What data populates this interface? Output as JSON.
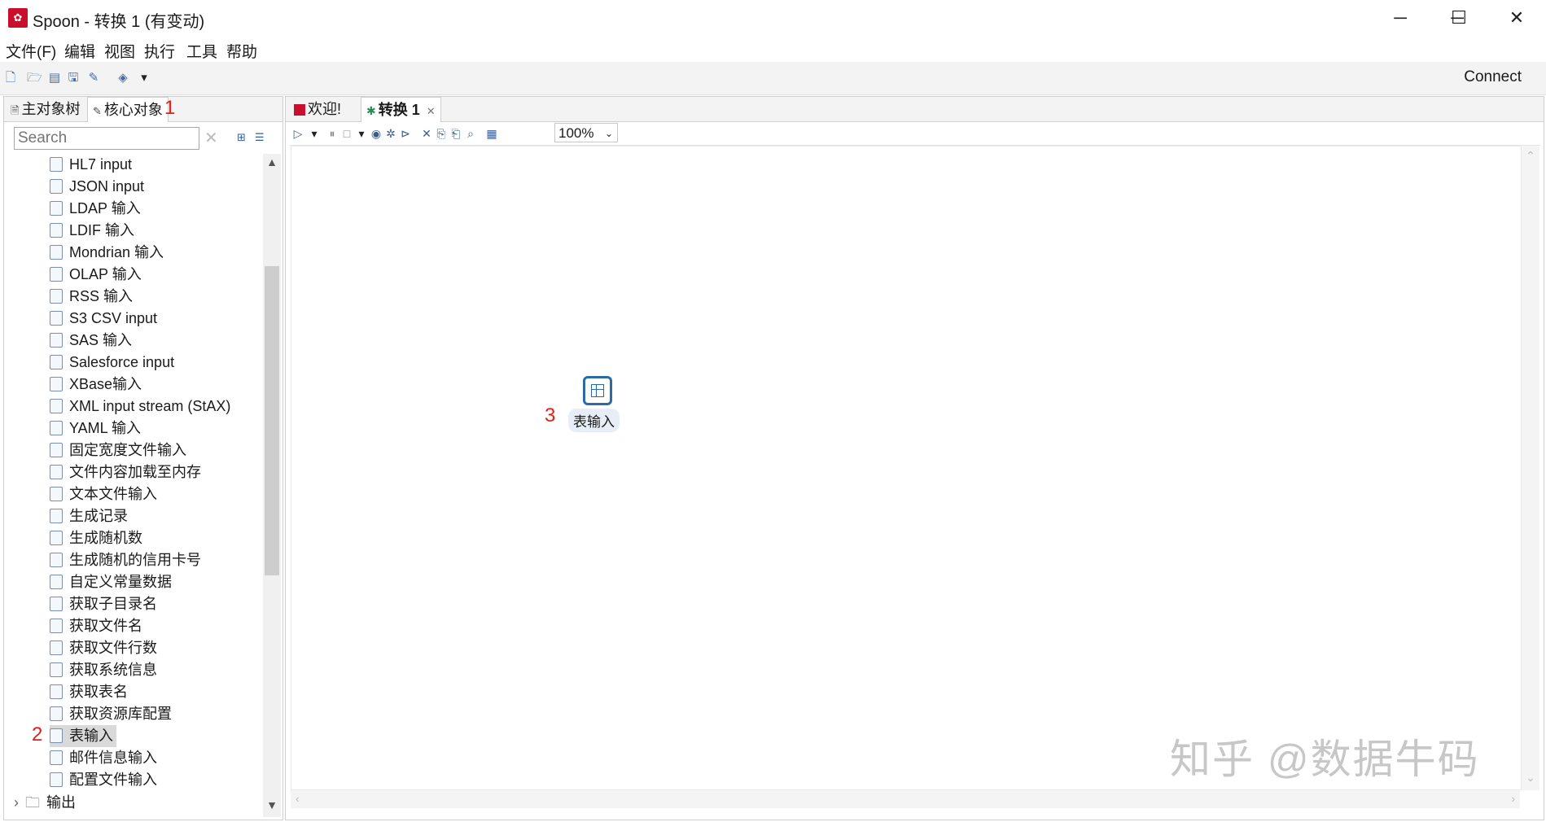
{
  "window": {
    "title": "Spoon - 转换 1 (有变动)",
    "app_icon": "spoon-logo",
    "minimize": "─",
    "maximize": "☐",
    "close": "✕"
  },
  "menu": [
    "文件(F)",
    "编辑",
    "视图",
    "执行",
    "工具",
    "帮助"
  ],
  "toolbar": {
    "connect_label": "Connect"
  },
  "left_panel": {
    "tabs": [
      {
        "label": "主对象树",
        "icon": "document-icon"
      },
      {
        "label": "核心对象",
        "icon": "pencil-icon"
      }
    ],
    "search_placeholder": "Search",
    "tree_items": [
      "HL7 input",
      "JSON input",
      "LDAP 输入",
      "LDIF 输入",
      "Mondrian 输入",
      "OLAP 输入",
      "RSS 输入",
      "S3 CSV input",
      "SAS 输入",
      "Salesforce input",
      "XBase输入",
      "XML input stream (StAX)",
      "YAML 输入",
      "固定宽度文件输入",
      "文件内容加载至内存",
      "文本文件输入",
      "生成记录",
      "生成随机数",
      "生成随机的信用卡号",
      "自定义常量数据",
      "获取子目录名",
      "获取文件名",
      "获取文件行数",
      "获取系统信息",
      "获取表名",
      "获取资源库配置",
      "表输入",
      "邮件信息输入",
      "配置文件输入"
    ],
    "selected_item": "表输入",
    "folder": "输出"
  },
  "annotations": {
    "a1": "1",
    "a2": "2",
    "a3": "3"
  },
  "editor": {
    "tabs": [
      {
        "label": "欢迎!",
        "icon": "spoon-icon"
      },
      {
        "label": "转换 1",
        "icon": "transformation-icon",
        "close": "✕"
      }
    ],
    "zoom": "100%",
    "step_label": "表输入"
  },
  "watermark": "知乎 @数据牛码"
}
